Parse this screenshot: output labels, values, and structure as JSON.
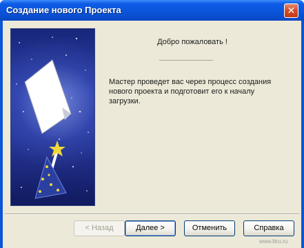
{
  "window": {
    "title": "Создание нового Проекта",
    "close_glyph": "✕"
  },
  "content": {
    "welcome": "Добро пожаловать !",
    "description": "Мастер проведет вас через процесс создания нового проекта и подготовит его к началу загрузки."
  },
  "buttons": {
    "back": "< Назад",
    "next": "Далее >",
    "cancel": "Отменить",
    "help": "Справка"
  },
  "watermark": "www.litru.ru",
  "icons": {
    "banner": "wizard-hat-and-page-illustration"
  },
  "colors": {
    "titlebar": "#0a54d9",
    "client": "#ece9d8",
    "banner": "#2b3fa8",
    "close": "#d64a25"
  }
}
